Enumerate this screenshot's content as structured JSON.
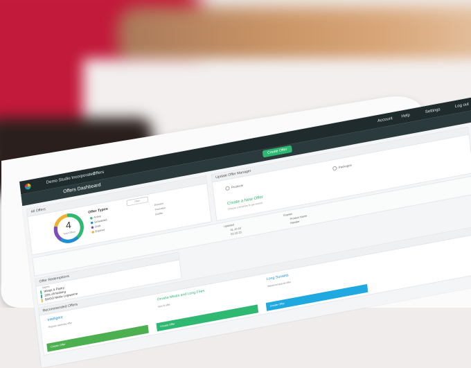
{
  "app": {
    "workspace": "Demo Studio Incorporated",
    "nav_offers": "Offers",
    "page_title": "Offers Dashboard",
    "create_button": "Create Offer",
    "top_right": [
      "Account",
      "Help",
      "Settings",
      "Log out"
    ]
  },
  "all_offers": {
    "header": "All Offers",
    "count": "4",
    "count_label": "Total Offers",
    "legend_title": "Offer Types",
    "legend": [
      {
        "label": "Active",
        "color": "#2eb872"
      },
      {
        "label": "Scheduled",
        "color": "#1b8fd0"
      },
      {
        "label": "Draft",
        "color": "#7c4dbd"
      },
      {
        "label": "Expired",
        "color": "#f0b030"
      }
    ],
    "filter_label": "Filter",
    "side_list": [
      "Discount",
      "Promotion",
      "Bundle"
    ]
  },
  "right_panel": {
    "header": "Update Offer Manager",
    "option_a": "Products",
    "option_b": "Packages",
    "link_title": "Create a New Offer",
    "link_sub": "Choose a template to get started"
  },
  "mid_panel": {
    "col_a_label": "Updated",
    "col_b_label": "Expires",
    "rows": [
      "01-10-15",
      "02-15-15",
      "03-03-15"
    ],
    "rows_b": [
      "Product Name",
      "Retailer",
      "Region"
    ]
  },
  "redemptions": {
    "header": "Offer Redemptions",
    "col_label": "Name",
    "rows": [
      "Wings & Pastry",
      "20% off Nothing",
      "BOGO Nickle Legwarme"
    ]
  },
  "recommended": {
    "header": "Recommended Offers",
    "cards": [
      {
        "title": "Intelligent",
        "body": "Regular weekday offer",
        "bar": "Create Offer"
      },
      {
        "title": "Omaha Meats and Long Fries",
        "body": "Item B offer",
        "bar": "Create Offer"
      },
      {
        "title": "Long Sunsets",
        "body": "Weekend special offer",
        "bar": "Create Offer"
      }
    ]
  }
}
